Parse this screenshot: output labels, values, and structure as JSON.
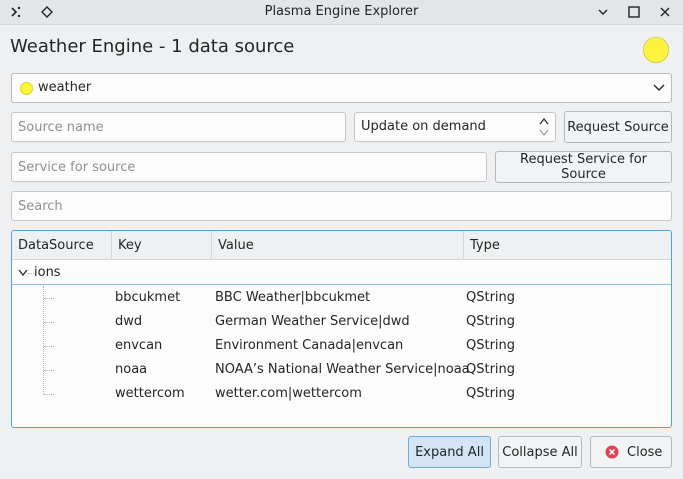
{
  "window": {
    "title": "Plasma Engine Explorer"
  },
  "heading": "Weather Engine - 1 data source",
  "engine_combo": {
    "selected": "weather"
  },
  "source_name": {
    "placeholder": "Source name",
    "value": ""
  },
  "update_mode": {
    "value": "Update on demand"
  },
  "request_source_label": "Request Source",
  "service_source": {
    "placeholder": "Service for source",
    "value": ""
  },
  "request_service_label": "Request Service for Source",
  "search": {
    "placeholder": "Search",
    "value": ""
  },
  "tree": {
    "columns": [
      "DataSource",
      "Key",
      "Value",
      "Type"
    ],
    "root": {
      "label": "ions",
      "expanded": true
    },
    "rows": [
      {
        "key": "bbcukmet",
        "value": "BBC Weather|bbcukmet",
        "type": "QString"
      },
      {
        "key": "dwd",
        "value": "German Weather Service|dwd",
        "type": "QString"
      },
      {
        "key": "envcan",
        "value": "Environment Canada|envcan",
        "type": "QString"
      },
      {
        "key": "noaa",
        "value": "NOAA’s National Weather Service|noaa",
        "type": "QString"
      },
      {
        "key": "wettercom",
        "value": "wetter.com|wettercom",
        "type": "QString"
      }
    ]
  },
  "buttons": {
    "expand_all": "Expand All",
    "collapse_all": "Collapse All",
    "close": "Close"
  },
  "colors": {
    "status": "#fcf33c",
    "accent": "#3daee9",
    "close_icon": "#da4453"
  }
}
